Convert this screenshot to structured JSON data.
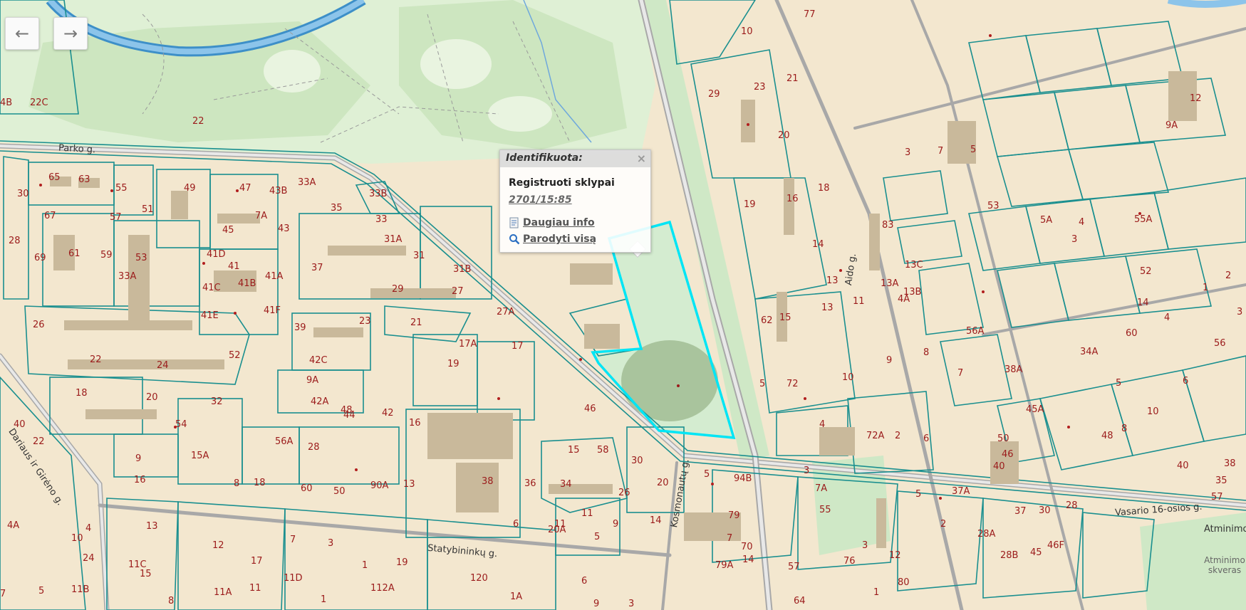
{
  "nav": {
    "back_icon": "←",
    "forward_icon": "→"
  },
  "popup": {
    "title": "Identifikuota:",
    "close": "×",
    "type": "Registruoti sklypai",
    "parcel_id": "2701/15:85",
    "more_info": "Daugiau info",
    "show_all": "Parodyti visą"
  },
  "streets": [
    "Parko g.",
    "Dariaus ir Girėno g.",
    "Statybininkų g.",
    "Kosmonautų g.",
    "Aido g.",
    "Vasario 16-osios g.",
    "Atminimo",
    "Atminimo skveras"
  ],
  "labels": [
    "4B",
    "22C",
    "22",
    "65",
    "63",
    "55",
    "49",
    "47",
    "43B",
    "33A",
    "33B",
    "30",
    "67",
    "57",
    "51",
    "7A",
    "45",
    "43",
    "35",
    "33",
    "28",
    "31A",
    "69",
    "61",
    "59",
    "53",
    "41D",
    "41",
    "31",
    "31B",
    "33A",
    "41C",
    "41B",
    "41A",
    "37",
    "29",
    "27",
    "26",
    "41F",
    "41E",
    "39",
    "23",
    "21",
    "27A",
    "52",
    "22",
    "24",
    "42C",
    "19",
    "17A",
    "17",
    "18",
    "20",
    "9A",
    "42A",
    "48",
    "42",
    "44",
    "32",
    "54",
    "16",
    "56A",
    "28",
    "46",
    "40",
    "22",
    "9",
    "15A",
    "15",
    "58",
    "30",
    "16",
    "18",
    "8",
    "60",
    "50",
    "90A",
    "13",
    "38",
    "36",
    "34",
    "26",
    "20",
    "14",
    "6",
    "11",
    "11",
    "9",
    "5",
    "20A",
    "4",
    "10",
    "24",
    "4A",
    "13",
    "12",
    "7",
    "3",
    "1",
    "19",
    "17",
    "11A",
    "11",
    "11D",
    "11C",
    "15",
    "112A",
    "11B",
    "8",
    "5",
    "7",
    "1",
    "120",
    "1A",
    "6",
    "9",
    "3",
    "5",
    "94B",
    "14",
    "79A",
    "79",
    "77",
    "10",
    "29",
    "23",
    "21",
    "20",
    "19",
    "18",
    "16",
    "14",
    "15",
    "13",
    "11",
    "10",
    "9",
    "8",
    "7",
    "6",
    "5",
    "72",
    "72A",
    "2",
    "4",
    "3",
    "70",
    "64",
    "62",
    "7A",
    "76",
    "80",
    "12",
    "1",
    "2",
    "5",
    "3",
    "7",
    "57",
    "55",
    "37A",
    "37",
    "30",
    "28",
    "28A",
    "28B",
    "45",
    "46F",
    "46",
    "40",
    "35",
    "38",
    "57",
    "55A",
    "12",
    "9A",
    "56",
    "56A",
    "34A",
    "60",
    "45A",
    "40",
    "50",
    "48",
    "10",
    "5",
    "8",
    "6",
    "4",
    "14",
    "2",
    "1",
    "3",
    "13",
    "13A",
    "13B",
    "13C",
    "4A",
    "38A",
    "52",
    "53",
    "5A",
    "4",
    "3",
    "7",
    "5",
    "3",
    "83"
  ]
}
